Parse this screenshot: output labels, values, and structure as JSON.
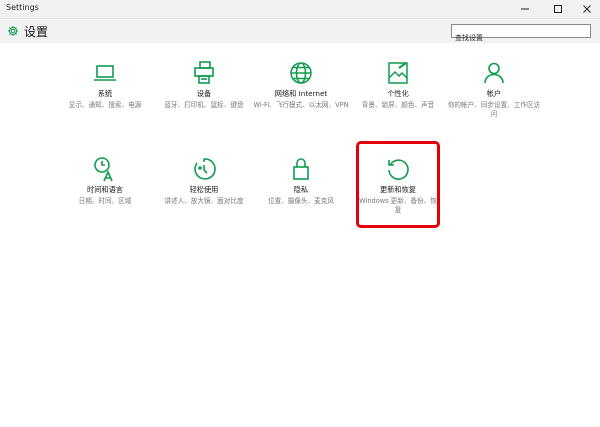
{
  "window": {
    "title": "Settings",
    "controls": {
      "minimize": "—",
      "maximize": "□",
      "close": "✕"
    }
  },
  "header": {
    "title": "设置",
    "gear_icon": "gear-icon",
    "accent": "#109b4f"
  },
  "search": {
    "placeholder": "查找设置"
  },
  "tiles": [
    {
      "name": "系统",
      "desc": "显示、通知、搜索、电源",
      "icon": "laptop-icon"
    },
    {
      "name": "设备",
      "desc": "蓝牙、打印机、鼠标、键盘",
      "icon": "devices-icon"
    },
    {
      "name": "网络和 Internet",
      "desc": "Wi-Fi、飞行模式、以太网、VPN",
      "icon": "globe-icon"
    },
    {
      "name": "个性化",
      "desc": "背景、锁屏、颜色、声音",
      "icon": "personalization-icon"
    },
    {
      "name": "帐户",
      "desc": "你的帐户、同步设置、工作区访问",
      "icon": "person-icon"
    },
    {
      "name": "时间和语言",
      "desc": "日期、时间、区域",
      "icon": "time-language-icon"
    },
    {
      "name": "轻松使用",
      "desc": "讲述人、放大镜、面对比度",
      "icon": "ease-of-access-icon"
    },
    {
      "name": "隐私",
      "desc": "位置、摄像头、麦克风",
      "icon": "lock-icon"
    },
    {
      "name": "更新和恢复",
      "desc": "Windows 更新、备份、恢复",
      "icon": "update-recovery-icon",
      "highlighted": true
    }
  ],
  "colors": {
    "icon_green": "#109b4f",
    "highlight_red": "#e3000b",
    "titlebar_bg": "#f2f2f2"
  }
}
